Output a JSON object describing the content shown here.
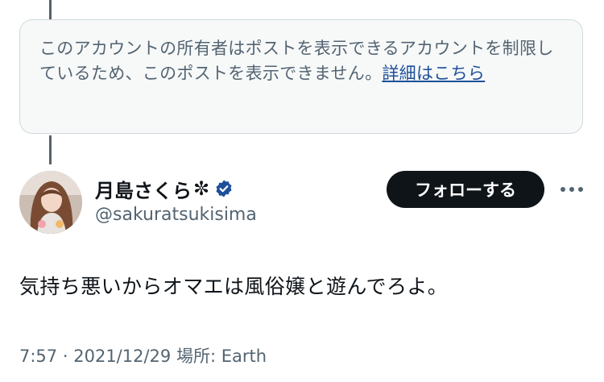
{
  "notice": {
    "text": "このアカウントの所有者はポストを表示できるアカウントを制限しているため、このポストを表示できません。",
    "link": "詳細はこちら"
  },
  "post": {
    "display_name": "月島さくら",
    "name_emoji": "✼",
    "verified_icon": "verified-badge-icon",
    "handle": "@sakuratsukisima",
    "follow_label": "フォローする",
    "more_icon": "more-horizontal-icon",
    "text": "気持ち悪いからオマエは風俗嬢と遊んでろよ。",
    "time": "7:57",
    "separator": "·",
    "date": "2021/12/29",
    "location_label": "場所:",
    "location": "Earth"
  },
  "colors": {
    "text": "#0f1419",
    "secondary": "#536471",
    "link": "#1d4f9a",
    "verified": "#1d9bf0",
    "button_bg": "#0f1419",
    "notice_bg": "#f7f9f9",
    "border": "#cfd9de"
  }
}
